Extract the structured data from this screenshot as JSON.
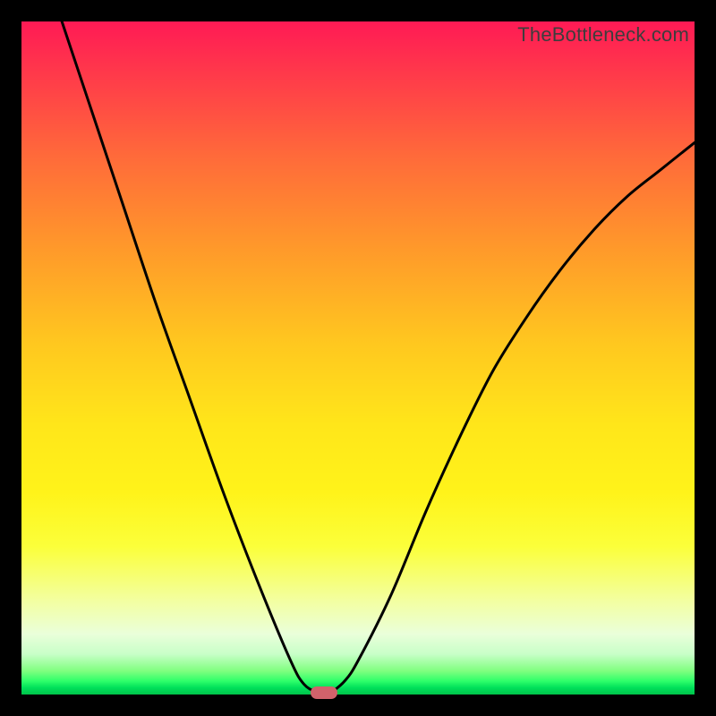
{
  "watermark": "TheBottleneck.com",
  "colors": {
    "frame_bg": "#000000",
    "curve": "#000000",
    "marker": "#d1626b"
  },
  "chart_data": {
    "type": "line",
    "title": "",
    "xlabel": "",
    "ylabel": "",
    "xlim": [
      0,
      100
    ],
    "ylim": [
      0,
      100
    ],
    "grid": false,
    "series": [
      {
        "name": "bottleneck-curve",
        "x": [
          0,
          5,
          10,
          15,
          20,
          25,
          30,
          35,
          40,
          42,
          44,
          45,
          46,
          48,
          50,
          55,
          60,
          65,
          70,
          75,
          80,
          85,
          90,
          95,
          100
        ],
        "y": [
          118,
          103,
          88,
          73,
          58,
          44,
          30,
          17,
          5,
          1.5,
          0.3,
          0,
          0.3,
          2,
          5,
          15,
          27,
          38,
          48,
          56,
          63,
          69,
          74,
          78,
          82
        ]
      }
    ],
    "marker": {
      "x": 45,
      "y": 0
    },
    "gradient_stops": [
      {
        "pos": 0,
        "color": "#ff1a55"
      },
      {
        "pos": 50,
        "color": "#ffe61a"
      },
      {
        "pos": 100,
        "color": "#00c44a"
      }
    ]
  }
}
